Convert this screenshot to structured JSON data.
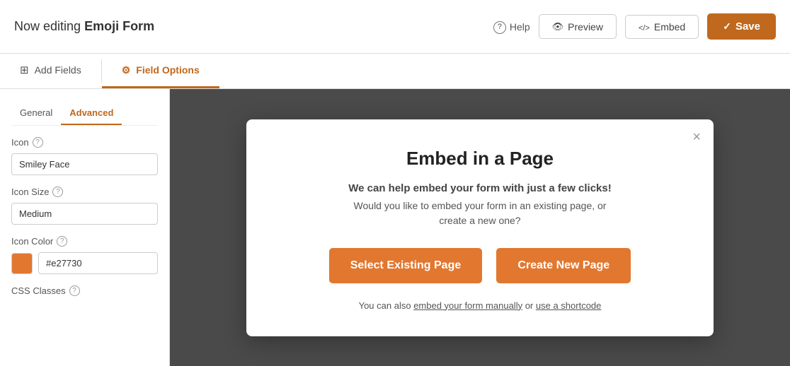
{
  "header": {
    "title_prefix": "Now editing ",
    "title_bold": "Emoji Form",
    "help_label": "Help",
    "preview_label": "Preview",
    "embed_label": "Embed",
    "save_label": "Save"
  },
  "tabs": {
    "add_fields_label": "Add Fields",
    "field_options_label": "Field Options"
  },
  "sub_tabs": {
    "general_label": "General",
    "advanced_label": "Advanced"
  },
  "left_panel": {
    "icon_label": "Icon",
    "icon_value": "Smiley Face",
    "icon_size_label": "Icon Size",
    "icon_size_value": "Medium",
    "icon_color_label": "Icon Color",
    "icon_color_value": "#e27730",
    "css_classes_label": "CSS Classes"
  },
  "modal": {
    "close_label": "×",
    "title": "Embed in a Page",
    "subtitle": "We can help embed your form with just a few clicks!",
    "description": "Would you like to embed your form in an existing page, or\ncreate a new one?",
    "select_existing_label": "Select Existing Page",
    "create_new_label": "Create New Page",
    "footer_text": "You can also ",
    "footer_link1": "embed your form manually",
    "footer_or": " or ",
    "footer_link2": "use a shortcode"
  }
}
